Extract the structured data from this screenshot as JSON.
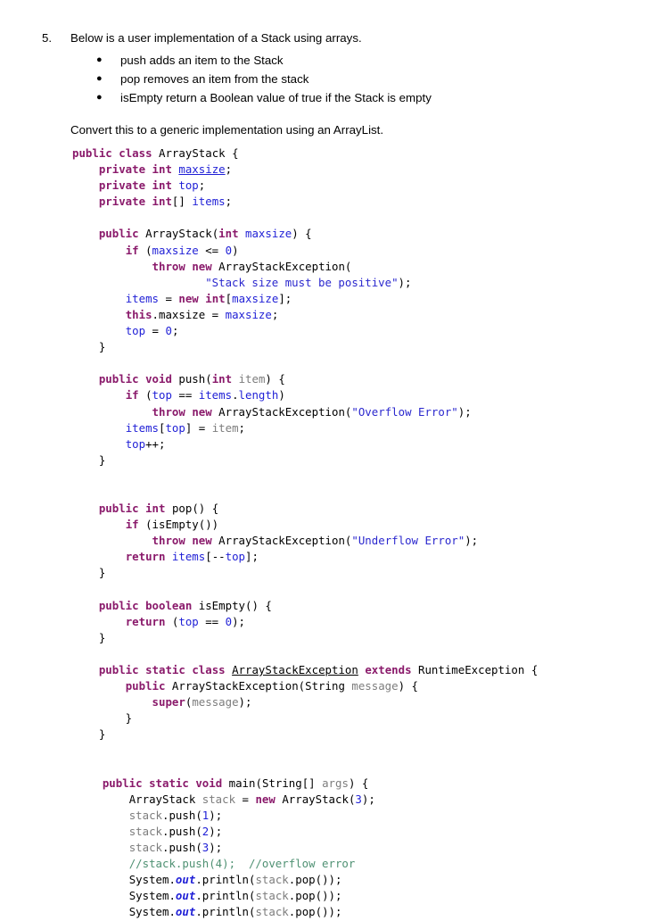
{
  "question": {
    "number": "5.",
    "stem": "Below is a user implementation of a Stack using arrays.",
    "bullet_glyph": "●",
    "bullets": [
      "push adds an item to the Stack",
      "pop removes an item from the stack",
      "isEmpty return a Boolean value of true if the Stack is empty"
    ],
    "convert_instruction": "Convert this to a generic implementation using an ArrayList."
  },
  "colors": {
    "keyword": "#8a1a6b",
    "field": "#1f1fd6",
    "string": "#2b28ce",
    "parameter": "#7d7d7d",
    "comment": "#4f9173",
    "plain": "#000000",
    "background": "#ffffff"
  },
  "code": {
    "language": "java",
    "class_name": "ArrayStack",
    "lines": [
      "public class ArrayStack {",
      "    private int maxsize;",
      "    private int top;",
      "    private int[] items;",
      "",
      "    public ArrayStack(int maxsize) {",
      "        if (maxsize <= 0)",
      "            throw new ArrayStackException(",
      "                    \"Stack size must be positive\");",
      "        items = new int[maxsize];",
      "        this.maxsize = maxsize;",
      "        top = 0;",
      "    }",
      "",
      "    public void push(int item) {",
      "        if (top == items.length)",
      "            throw new ArrayStackException(\"Overflow Error\");",
      "        items[top] = item;",
      "        top++;",
      "    }",
      "",
      "",
      "    public int pop() {",
      "        if (isEmpty())",
      "            throw new ArrayStackException(\"Underflow Error\");",
      "        return items[--top];",
      "    }",
      "",
      "    public boolean isEmpty() {",
      "        return (top == 0);",
      "    }",
      "",
      "    public static class ArrayStackException extends RuntimeException {",
      "        public ArrayStackException(String message) {",
      "            super(message);",
      "        }",
      "    }",
      "",
      "",
      "    public static void main(String[] args) {",
      "        ArrayStack stack = new ArrayStack(3);",
      "        stack.push(1);",
      "        stack.push(2);",
      "        stack.push(3);",
      "        //stack.push(4);  //overflow error",
      "        System.out.println(stack.pop());",
      "        System.out.println(stack.pop());",
      "        System.out.println(stack.pop());"
    ]
  }
}
